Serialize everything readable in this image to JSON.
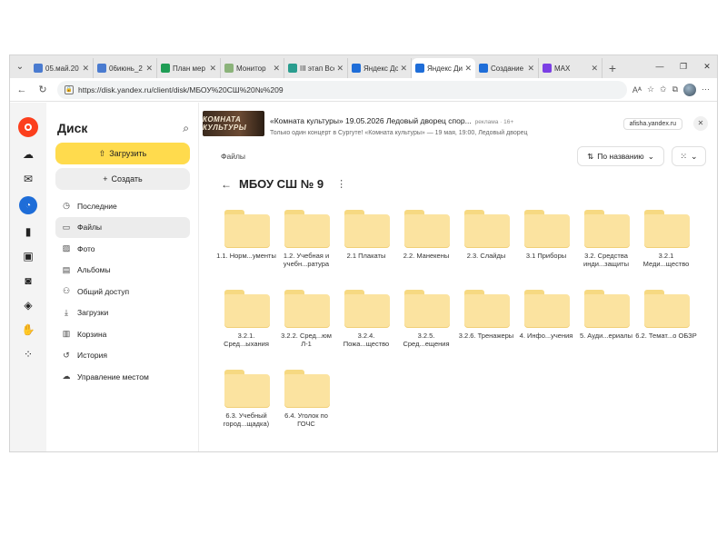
{
  "browser": {
    "tabs": [
      {
        "title": "05.май.20",
        "color": "#4a7bd0"
      },
      {
        "title": "06июнь_2",
        "color": "#4a7bd0"
      },
      {
        "title": "План мер",
        "color": "#1f9d55"
      },
      {
        "title": "Монитор",
        "color": "#8bb37a"
      },
      {
        "title": "III этап Все",
        "color": "#2a9d8f"
      },
      {
        "title": "Яндекс До",
        "color": "#1e6dd8"
      },
      {
        "title": "Яндекс Ди",
        "color": "#1e6dd8",
        "active": true
      },
      {
        "title": "Создание",
        "color": "#1e6dd8"
      },
      {
        "title": "MAX",
        "color": "#7b3fe4"
      }
    ],
    "url": "https://disk.yandex.ru/client/disk/МБОУ%20СШ%20№%209"
  },
  "sidebar": {
    "title": "Диск",
    "upload_label": "Загрузить",
    "create_label": "Создать",
    "items": [
      {
        "label": "Последние",
        "icon": "clock-icon"
      },
      {
        "label": "Файлы",
        "icon": "folder-icon",
        "active": true
      },
      {
        "label": "Фото",
        "icon": "photo-icon"
      },
      {
        "label": "Альбомы",
        "icon": "album-icon"
      },
      {
        "label": "Общий доступ",
        "icon": "share-icon"
      },
      {
        "label": "Загрузки",
        "icon": "download-icon"
      },
      {
        "label": "Корзина",
        "icon": "trash-icon"
      },
      {
        "label": "История",
        "icon": "history-icon"
      },
      {
        "label": "Управление местом",
        "icon": "cloud-icon"
      }
    ]
  },
  "ad": {
    "image_text": "КОМНАТА КУЛЬТУРЫ",
    "title": "«Комната культуры» 19.05.2026 Ледовый дворец спор...",
    "meta": "реклама · 16+",
    "subtitle": "Только один концерт в Сургуте! «Комната культуры» — 19 мая, 19:00, Ледовый дворец",
    "link": "afisha.yandex.ru"
  },
  "main": {
    "breadcrumb": "Файлы",
    "sort_label": "По названию",
    "folder_title": "МБОУ СШ № 9",
    "folders": [
      "1.1. Норм...ументы",
      "1.2. Учебная и учебн...ратура",
      "2.1 Плакаты",
      "2.2. Манекены",
      "2.3. Слайды",
      "3.1 Приборы",
      "3.2. Средства инди...защиты",
      "3.2.1 Меди...щество",
      "3.2.1. Сред...ыхания",
      "3.2.2. Сред...юм Л-1",
      "3.2.4. Пожа...щество",
      "3.2.5. Сред...ещения",
      "3.2.6. Тренажеры",
      "4. Инфо...учения",
      "5. Ауди...ериалы",
      "6.2. Темат...о ОБЗР",
      "6.3. Учебный город...щадка)",
      "6.4. Уголок по ГОЧС"
    ]
  }
}
